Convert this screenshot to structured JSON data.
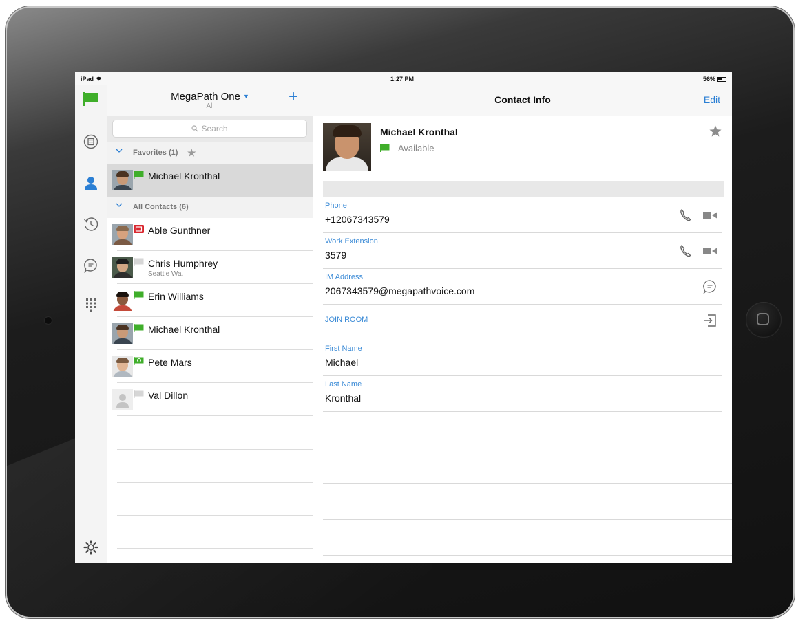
{
  "status_bar": {
    "device": "iPad",
    "time": "1:27 PM",
    "battery": "56%"
  },
  "sidebar": {
    "items": [
      {
        "name": "presence",
        "icon": "presence-flag-icon",
        "color": "#3fae2a"
      },
      {
        "name": "directory",
        "icon": "building-icon"
      },
      {
        "name": "contacts",
        "icon": "person-icon",
        "active": true,
        "color": "#2b7fd4"
      },
      {
        "name": "history",
        "icon": "clock-icon"
      },
      {
        "name": "chat",
        "icon": "chat-bubble-icon"
      },
      {
        "name": "dialpad",
        "icon": "dialpad-icon"
      },
      {
        "name": "settings",
        "icon": "gear-icon"
      }
    ]
  },
  "contacts_panel": {
    "account_name": "MegaPath One",
    "account_sub": "All",
    "search_placeholder": "Search",
    "favorites_label": "Favorites (1)",
    "all_contacts_label": "All Contacts (6)",
    "favorites": [
      {
        "name": "Michael Kronthal",
        "subtitle": "",
        "status": "available"
      }
    ],
    "contacts": [
      {
        "name": "Able Gunthner",
        "subtitle": "",
        "status": "busy"
      },
      {
        "name": "Chris Humphrey",
        "subtitle": "Seattle Wa.",
        "status": "offline"
      },
      {
        "name": "Erin Williams",
        "subtitle": "",
        "status": "available"
      },
      {
        "name": "Michael Kronthal",
        "subtitle": "",
        "status": "available"
      },
      {
        "name": "Pete Mars",
        "subtitle": "",
        "status": "available-chat"
      },
      {
        "name": "Val Dillon",
        "subtitle": "",
        "status": "offline"
      }
    ]
  },
  "detail": {
    "title": "Contact Info",
    "edit_label": "Edit",
    "contact_name": "Michael Kronthal",
    "presence": "Available",
    "fields": [
      {
        "label": "Phone",
        "value": "+12067343579",
        "actions": [
          "phone-icon",
          "video-camera-icon"
        ]
      },
      {
        "label": "Work Extension",
        "value": "3579",
        "actions": [
          "phone-icon",
          "video-camera-icon"
        ]
      },
      {
        "label": "IM Address",
        "value": "2067343579@megapathvoice.com",
        "actions": [
          "chat-bubble-icon"
        ]
      },
      {
        "label": "JOIN ROOM",
        "value": "",
        "actions": [
          "join-room-icon"
        ]
      },
      {
        "label": "First Name",
        "value": "Michael",
        "actions": []
      },
      {
        "label": "Last Name",
        "value": "Kronthal",
        "actions": []
      }
    ]
  },
  "colors": {
    "accent": "#2b7fd4",
    "available": "#3fae2a",
    "busy": "#d9262e",
    "offline": "#c9c9c9"
  }
}
